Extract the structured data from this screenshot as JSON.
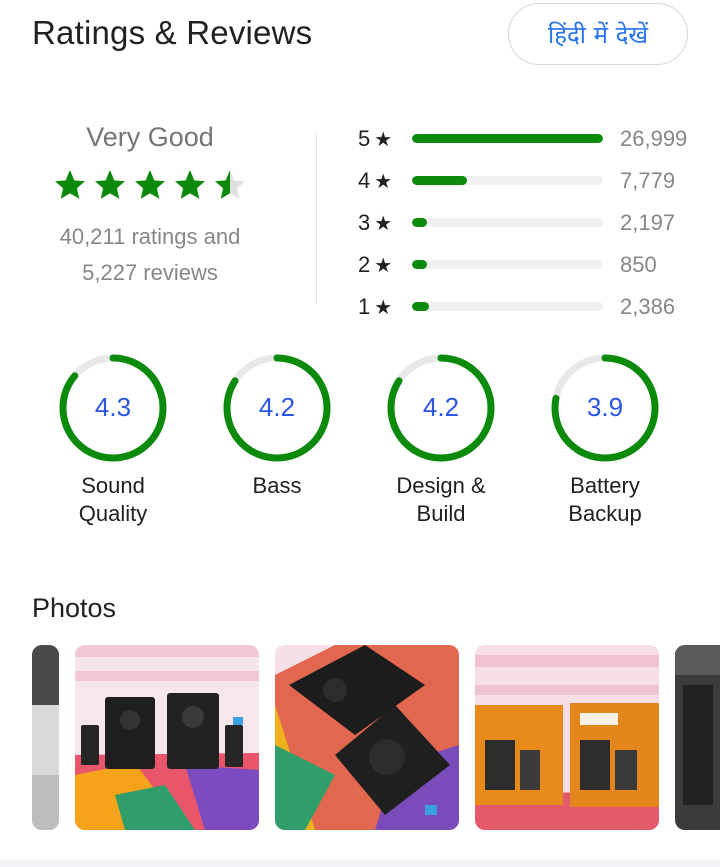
{
  "header": {
    "title": "Ratings & Reviews",
    "hindi_button": "हिंदी में देखें"
  },
  "summary": {
    "verdict": "Very Good",
    "rating_stars": 4.5,
    "ratings_text": "40,211 ratings and",
    "reviews_text": "5,227 reviews"
  },
  "distribution": [
    {
      "label": "5",
      "count": "26,999",
      "fraction": 1.0
    },
    {
      "label": "4",
      "count": "7,779",
      "fraction": 0.29
    },
    {
      "label": "3",
      "count": "2,197",
      "fraction": 0.081
    },
    {
      "label": "2",
      "count": "850",
      "fraction": 0.031
    },
    {
      "label": "1",
      "count": "2,386",
      "fraction": 0.088
    }
  ],
  "features": [
    {
      "value": "4.3",
      "line1": "Sound",
      "line2": "Quality",
      "fraction": 0.86
    },
    {
      "value": "4.2",
      "line1": "Bass",
      "line2": "",
      "fraction": 0.84
    },
    {
      "value": "4.2",
      "line1": "Design &",
      "line2": "Build",
      "fraction": 0.84
    },
    {
      "value": "3.9",
      "line1": "Battery",
      "line2": "Backup",
      "fraction": 0.78
    }
  ],
  "photos": {
    "title": "Photos"
  },
  "colors": {
    "accent_green": "#0b8a0b",
    "link_blue": "#2874f0",
    "rating_blue": "#2a55e5"
  }
}
